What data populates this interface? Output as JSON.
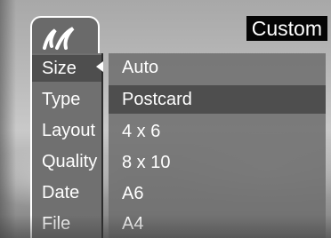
{
  "header": {
    "logo_icon": "handwriting-logo-icon",
    "mode_badge": "Custom"
  },
  "categories": [
    {
      "label": "Size",
      "selected": true
    },
    {
      "label": "Type",
      "selected": false
    },
    {
      "label": "Layout",
      "selected": false
    },
    {
      "label": "Quality",
      "selected": false
    },
    {
      "label": "Date",
      "selected": false
    },
    {
      "label": "File",
      "selected": false
    }
  ],
  "options": [
    {
      "label": "Auto",
      "selected": false
    },
    {
      "label": "Postcard",
      "selected": true
    },
    {
      "label": "4 x 6",
      "selected": false
    },
    {
      "label": "8 x 10",
      "selected": false
    },
    {
      "label": "A6",
      "selected": false
    },
    {
      "label": "A4",
      "selected": false
    }
  ],
  "colors": {
    "panel": "#707070",
    "selected_row": "#4e4e4e",
    "badge_bg": "#050505",
    "text": "#ffffff"
  }
}
